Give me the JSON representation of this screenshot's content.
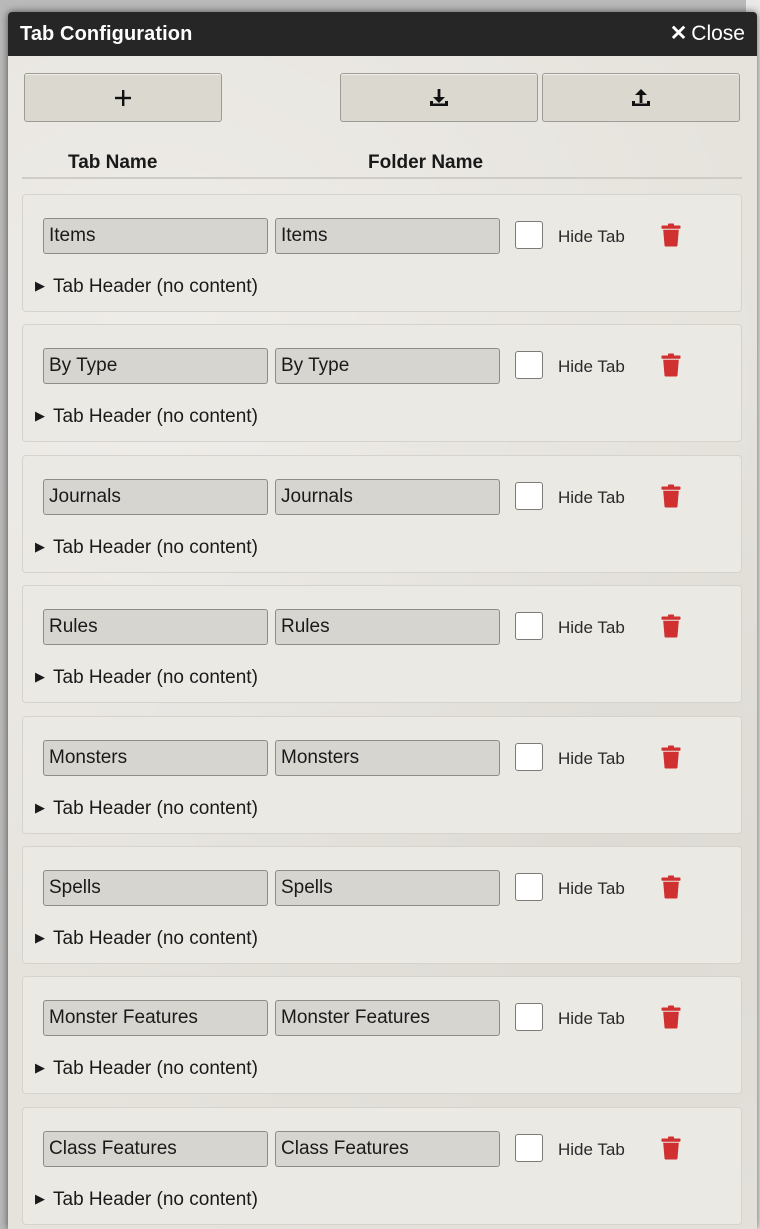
{
  "window": {
    "title": "Tab Configuration",
    "close_label": "Close"
  },
  "toolbar": {
    "add_icon": "plus-icon",
    "import_icon": "download-icon",
    "export_icon": "upload-icon"
  },
  "columns": {
    "tab_name": "Tab Name",
    "folder_name": "Folder Name"
  },
  "rows": [
    {
      "tab_name": "Items",
      "folder_name": "Items",
      "hide_label": "Hide Tab",
      "hidden": false,
      "header_summary": "Tab Header (no content)"
    },
    {
      "tab_name": "By Type",
      "folder_name": "By Type",
      "hide_label": "Hide Tab",
      "hidden": false,
      "header_summary": "Tab Header (no content)"
    },
    {
      "tab_name": "Journals",
      "folder_name": "Journals",
      "hide_label": "Hide Tab",
      "hidden": false,
      "header_summary": "Tab Header (no content)"
    },
    {
      "tab_name": "Rules",
      "folder_name": "Rules",
      "hide_label": "Hide Tab",
      "hidden": false,
      "header_summary": "Tab Header (no content)"
    },
    {
      "tab_name": "Monsters",
      "folder_name": "Monsters",
      "hide_label": "Hide Tab",
      "hidden": false,
      "header_summary": "Tab Header (no content)"
    },
    {
      "tab_name": "Spells",
      "folder_name": "Spells",
      "hide_label": "Hide Tab",
      "hidden": false,
      "header_summary": "Tab Header (no content)"
    },
    {
      "tab_name": "Monster Features",
      "folder_name": "Monster Features",
      "hide_label": "Hide Tab",
      "hidden": false,
      "header_summary": "Tab Header (no content)"
    },
    {
      "tab_name": "Class Features",
      "folder_name": "Class Features",
      "hide_label": "Hide Tab",
      "hidden": false,
      "header_summary": "Tab Header (no content)"
    }
  ],
  "colors": {
    "titlebar": "#262626",
    "delete_red": "#d03030"
  }
}
